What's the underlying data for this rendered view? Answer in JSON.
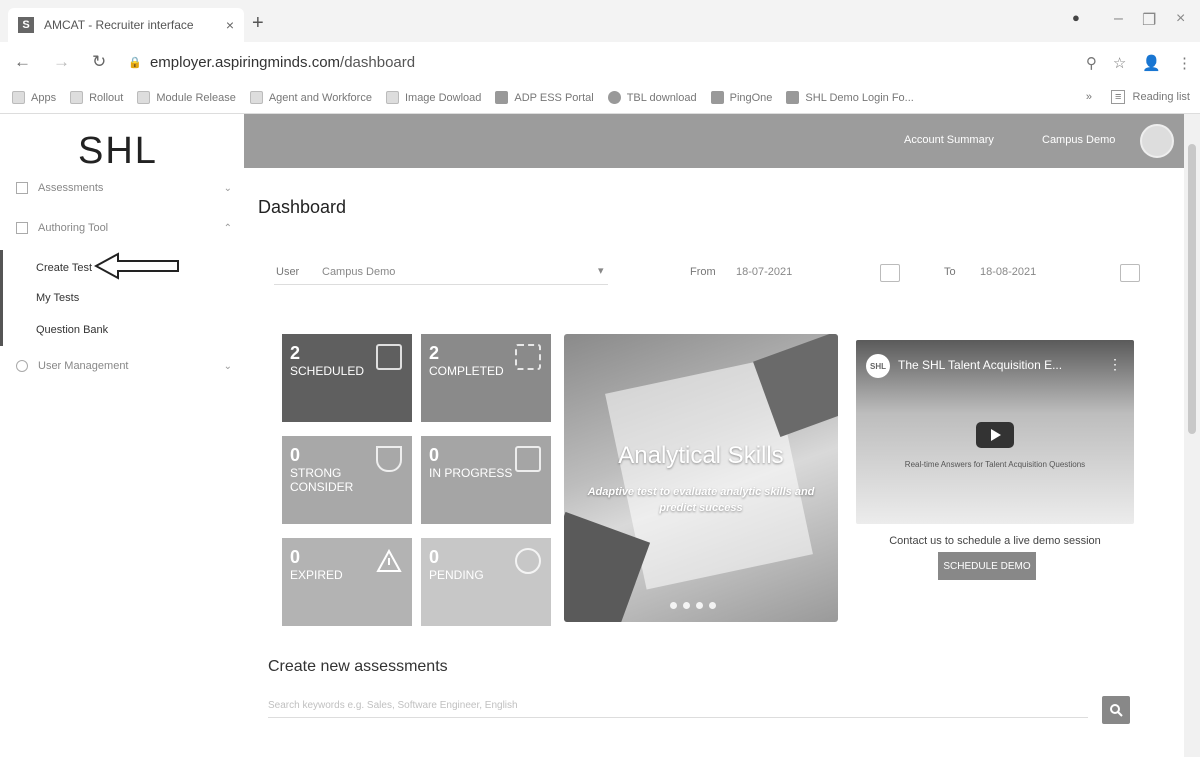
{
  "browser": {
    "tab_title": "AMCAT - Recruiter interface",
    "tab_favicon": "S",
    "url_host": "employer.aspiringminds.com",
    "url_path": "/dashboard",
    "bookmarks": [
      "Apps",
      "Rollout",
      "Module Release",
      "Agent and Workforce",
      "Image Dowload",
      "ADP ESS Portal",
      "TBL download",
      "PingOne",
      "SHL Demo Login Fo..."
    ],
    "more_bookmarks": "»",
    "reading_list": "Reading list"
  },
  "sidebar": {
    "logo": "SHL",
    "groups": [
      {
        "label": "Assessments",
        "icon": "assessments-icon"
      },
      {
        "label": "Authoring Tool",
        "icon": "authoring-icon"
      },
      {
        "label": "User Management",
        "icon": "user-management-icon"
      }
    ],
    "authoring_items": [
      "Create Test",
      "My Tests",
      "Question Bank"
    ]
  },
  "header": {
    "account_summary": "Account Summary",
    "user_name": "Campus Demo"
  },
  "dashboard": {
    "title": "Dashboard",
    "filters": {
      "user_label": "User",
      "user_value": "Campus Demo",
      "from_label": "From",
      "from_value": "18-07-2021",
      "to_label": "To",
      "to_value": "18-08-2021"
    },
    "tiles": [
      {
        "count": "2",
        "label": "SCHEDULED",
        "color": "#5f5f5f"
      },
      {
        "count": "2",
        "label": "COMPLETED",
        "color": "#8a8a8a"
      },
      {
        "count": "0",
        "label": "STRONG CONSIDER",
        "color": "#a8a8a8"
      },
      {
        "count": "0",
        "label": "IN PROGRESS",
        "color": "#a5a5a5"
      },
      {
        "count": "0",
        "label": "EXPIRED",
        "color": "#b3b3b3"
      },
      {
        "count": "0",
        "label": "PENDING",
        "color": "#c7c7c7"
      }
    ],
    "banner": {
      "title": "Analytical Skills",
      "subtitle": "Adaptive test to evaluate analytic skills and predict success",
      "slides": 4
    },
    "video": {
      "channel": "SHL",
      "title": "The SHL Talent Acquisition E...",
      "caption": "Real-time Answers for Talent Acquisition Questions"
    },
    "contact_text": "Contact us to schedule a live demo session",
    "demo_button": "SCHEDULE DEMO",
    "create_section_title": "Create new assessments",
    "search_placeholder": "Search keywords e.g. Sales, Software Engineer, English"
  }
}
